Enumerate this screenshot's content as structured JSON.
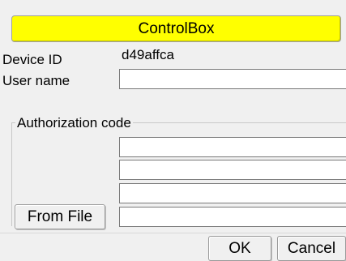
{
  "window": {
    "title": "ControlBox",
    "accent_color": "#ffff00"
  },
  "device": {
    "label": "Device ID",
    "value": "d49affca"
  },
  "user": {
    "label": "User name",
    "value": ""
  },
  "authorization": {
    "group_label": "Authorization code",
    "lines": [
      "",
      "",
      "",
      ""
    ]
  },
  "buttons": {
    "from_file": "From File",
    "ok": "OK",
    "cancel": "Cancel"
  }
}
